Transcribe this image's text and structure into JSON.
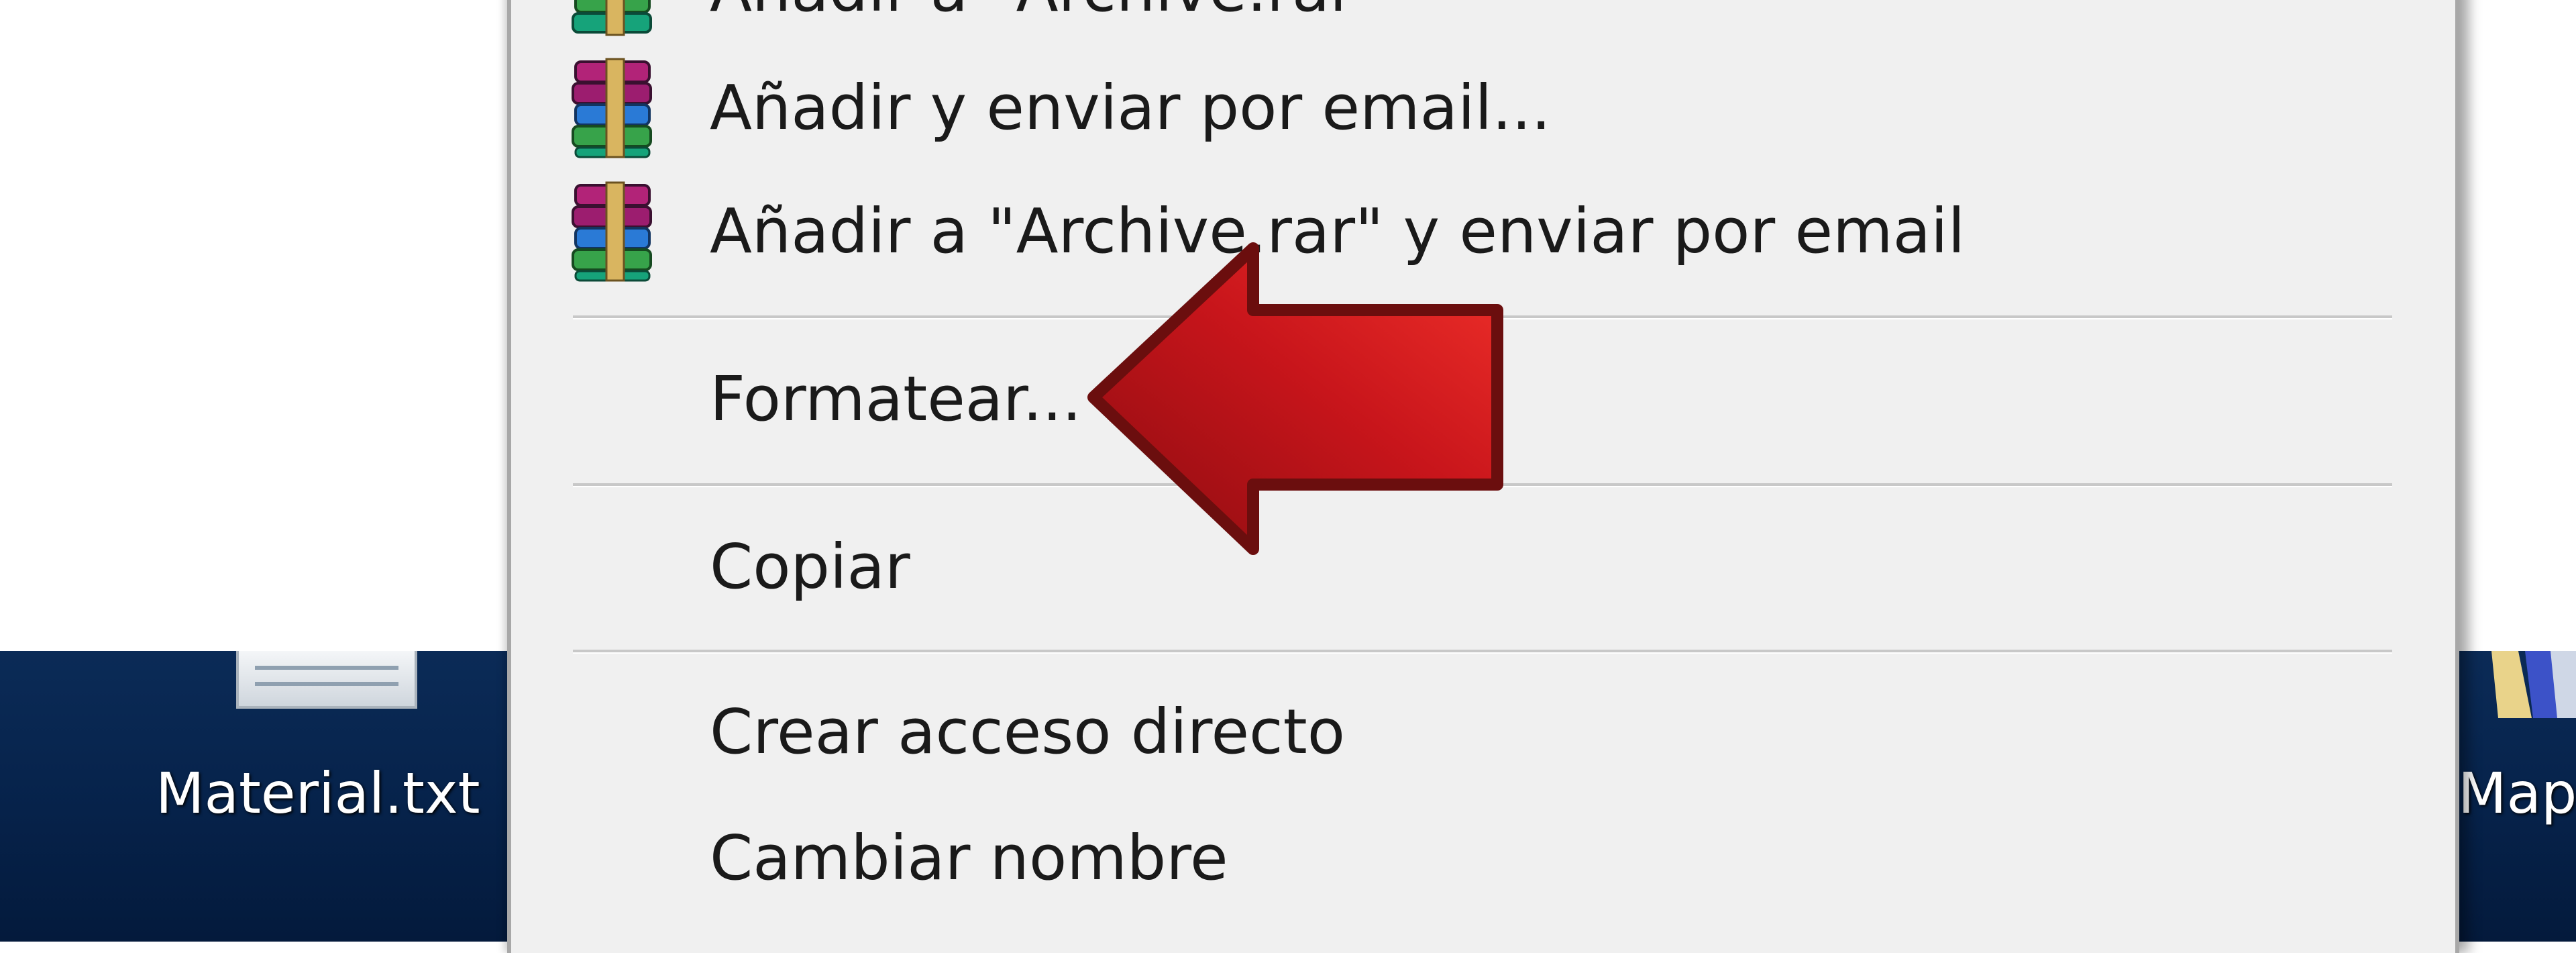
{
  "desktop": {
    "files": [
      {
        "label": "Material.txt",
        "icon": "text-file-icon"
      },
      {
        "label": "Map",
        "icon": "folder-icon"
      }
    ]
  },
  "context_menu": {
    "items": [
      {
        "label": "Añadir a \"Archive.rar\"",
        "icon": "winrar-icon"
      },
      {
        "label": "Añadir y enviar por email...",
        "icon": "winrar-icon"
      },
      {
        "label": "Añadir a \"Archive.rar\" y enviar por email",
        "icon": "winrar-icon"
      },
      {
        "label": "Formatear..."
      },
      {
        "label": "Copiar"
      },
      {
        "label": "Crear acceso directo"
      },
      {
        "label": "Cambiar nombre"
      }
    ]
  },
  "annotation": {
    "arrow_color": "#c8151b",
    "arrow_outline": "#6b0e0e",
    "icon": "red-arrow-icon"
  },
  "colors": {
    "desktop_background": "#06224a",
    "menu_background": "#f0f0f0",
    "menu_text": "#1a1a1a"
  }
}
